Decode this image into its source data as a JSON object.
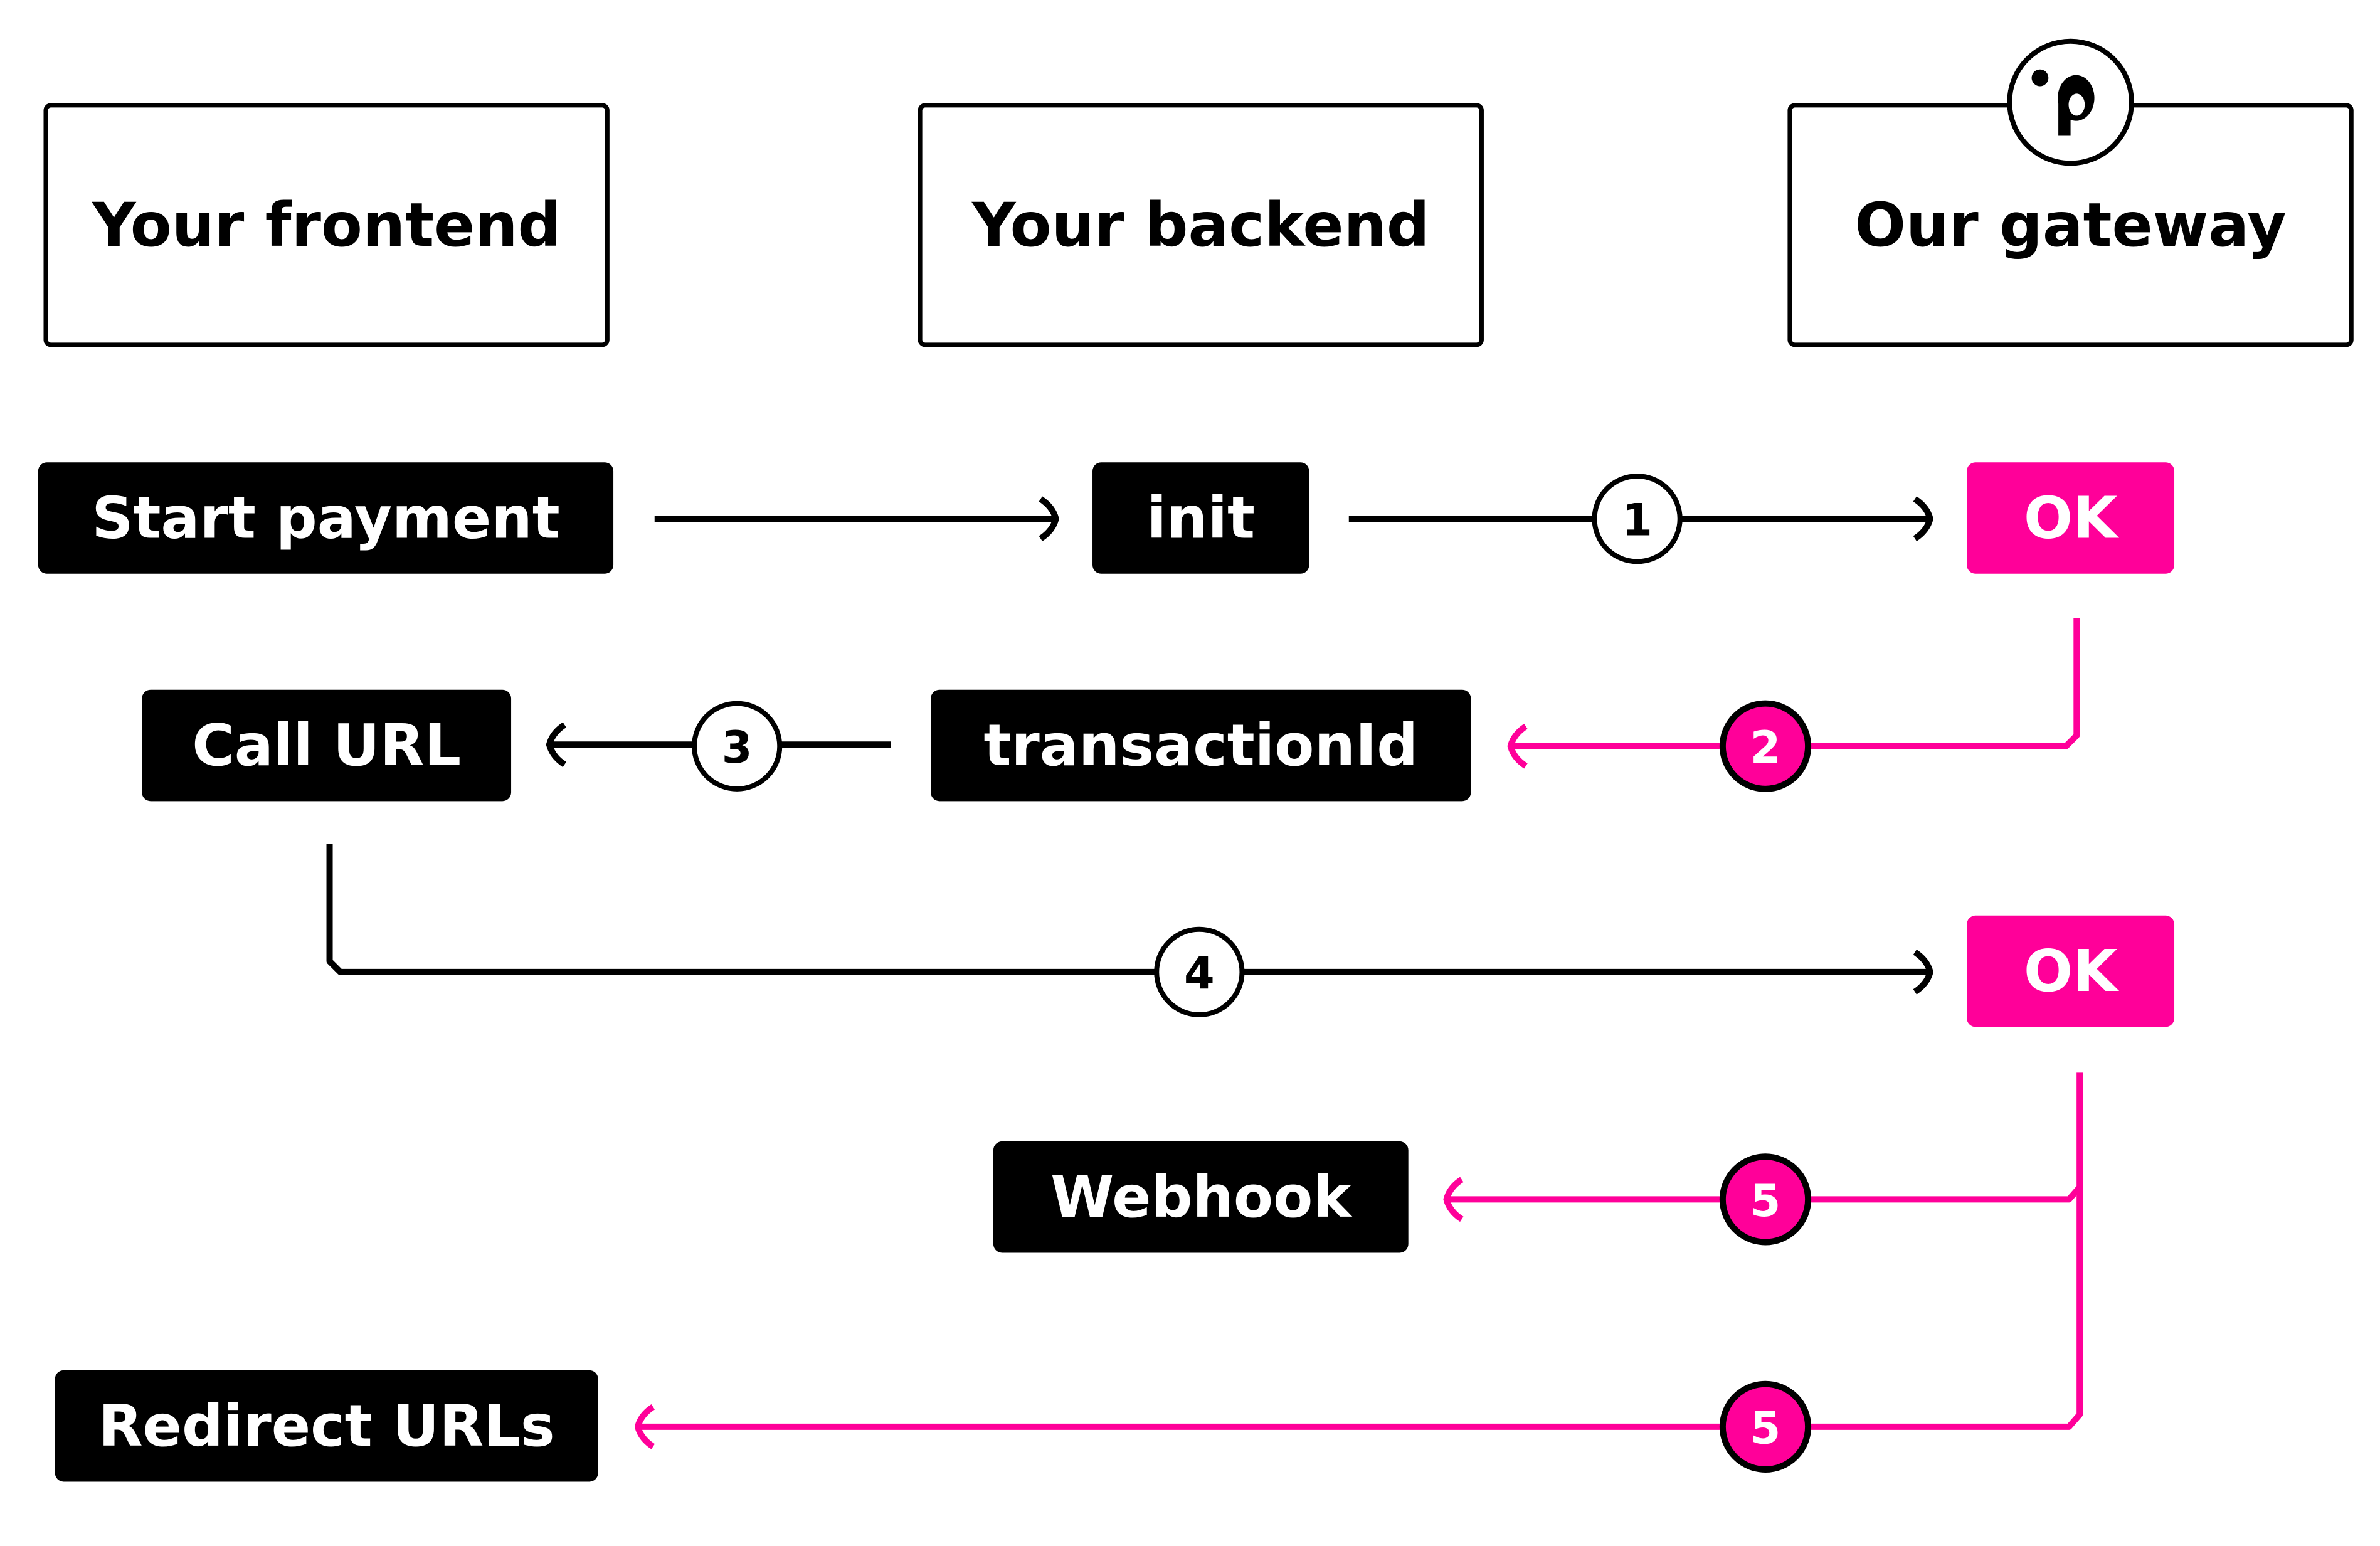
{
  "lanes": [
    {
      "id": "frontend",
      "label": "Your frontend"
    },
    {
      "id": "backend",
      "label": "Your backend"
    },
    {
      "id": "gateway",
      "label": "Our gateway",
      "logo": "brand-p-logo-icon"
    }
  ],
  "nodes": [
    {
      "id": "start_payment",
      "label": "Start payment",
      "lane": "frontend",
      "style": "dark"
    },
    {
      "id": "init",
      "label": "init",
      "lane": "backend",
      "style": "dark"
    },
    {
      "id": "ok_1",
      "label": "OK",
      "lane": "gateway",
      "style": "accent"
    },
    {
      "id": "call_url",
      "label": "Call URL",
      "lane": "frontend",
      "style": "dark"
    },
    {
      "id": "transaction_id",
      "label": "transactionId",
      "lane": "backend",
      "style": "dark"
    },
    {
      "id": "ok_2",
      "label": "OK",
      "lane": "gateway",
      "style": "accent"
    },
    {
      "id": "webhook",
      "label": "Webhook",
      "lane": "backend",
      "style": "dark"
    },
    {
      "id": "redirect_urls",
      "label": "Redirect URLs",
      "lane": "frontend",
      "style": "dark"
    }
  ],
  "edges": [
    {
      "id": "e_start_init",
      "from": "start_payment",
      "to": "init",
      "style": "dark",
      "step": null
    },
    {
      "id": "e_init_ok1",
      "from": "init",
      "to": "ok_1",
      "style": "dark",
      "step": "1"
    },
    {
      "id": "e_ok1_txid",
      "from": "ok_1",
      "to": "transaction_id",
      "style": "accent",
      "step": "2"
    },
    {
      "id": "e_txid_callurl",
      "from": "transaction_id",
      "to": "call_url",
      "style": "dark",
      "step": "3"
    },
    {
      "id": "e_callurl_ok2",
      "from": "call_url",
      "to": "ok_2",
      "style": "dark",
      "step": "4"
    },
    {
      "id": "e_ok2_webhook",
      "from": "ok_2",
      "to": "webhook",
      "style": "accent",
      "step": "5"
    },
    {
      "id": "e_ok2_redirect",
      "from": "ok_2",
      "to": "redirect_urls",
      "style": "accent",
      "step": "5"
    }
  ],
  "colors": {
    "accent": "#ff0099",
    "dark": "#000000",
    "background": "#ffffff"
  }
}
